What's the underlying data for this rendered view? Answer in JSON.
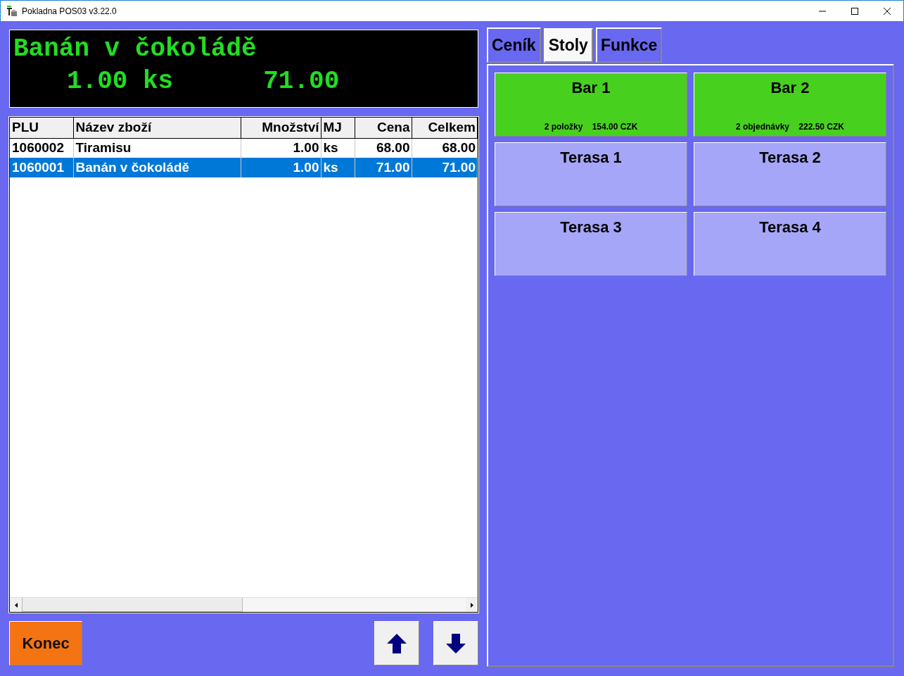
{
  "window": {
    "title": "Pokladna POS03 v3.22.0"
  },
  "display": {
    "item": "Banán v čokoládě",
    "quantity": "1.00 ks",
    "amount": "71.00"
  },
  "receipt": {
    "columns": [
      {
        "label": "PLU",
        "kind": "text"
      },
      {
        "label": "Název zboží",
        "kind": "text"
      },
      {
        "label": "Množství",
        "kind": "number"
      },
      {
        "label": "MJ",
        "kind": "text"
      },
      {
        "label": "Cena",
        "kind": "number"
      },
      {
        "label": "Celkem",
        "kind": "number"
      }
    ],
    "rows": [
      {
        "cells": [
          "1060002",
          "Tiramisu",
          "1.00",
          "ks",
          "68.00",
          "68.00"
        ],
        "selected": false
      },
      {
        "cells": [
          "1060001",
          "Banán v čokoládě",
          "1.00",
          "ks",
          "71.00",
          "71.00"
        ],
        "selected": true
      }
    ]
  },
  "buttons": {
    "exit": "Konec"
  },
  "tabs": [
    {
      "label": "Ceník",
      "selected": false
    },
    {
      "label": "Stoly",
      "selected": true
    },
    {
      "label": "Funkce",
      "selected": false
    }
  ],
  "tables": [
    {
      "name": "Bar 1",
      "color": "#48d01e",
      "info": "2 položky    154.00 CZK"
    },
    {
      "name": "Bar 2",
      "color": "#48d01e",
      "info": "2 objednávky    222.50 CZK"
    },
    {
      "name": "Terasa 1",
      "color": "#a6a6f8"
    },
    {
      "name": "Terasa 2",
      "color": "#a6a6f8"
    },
    {
      "name": "Terasa 3",
      "color": "#a6a6f8"
    },
    {
      "name": "Terasa 4",
      "color": "#a6a6f8"
    }
  ]
}
